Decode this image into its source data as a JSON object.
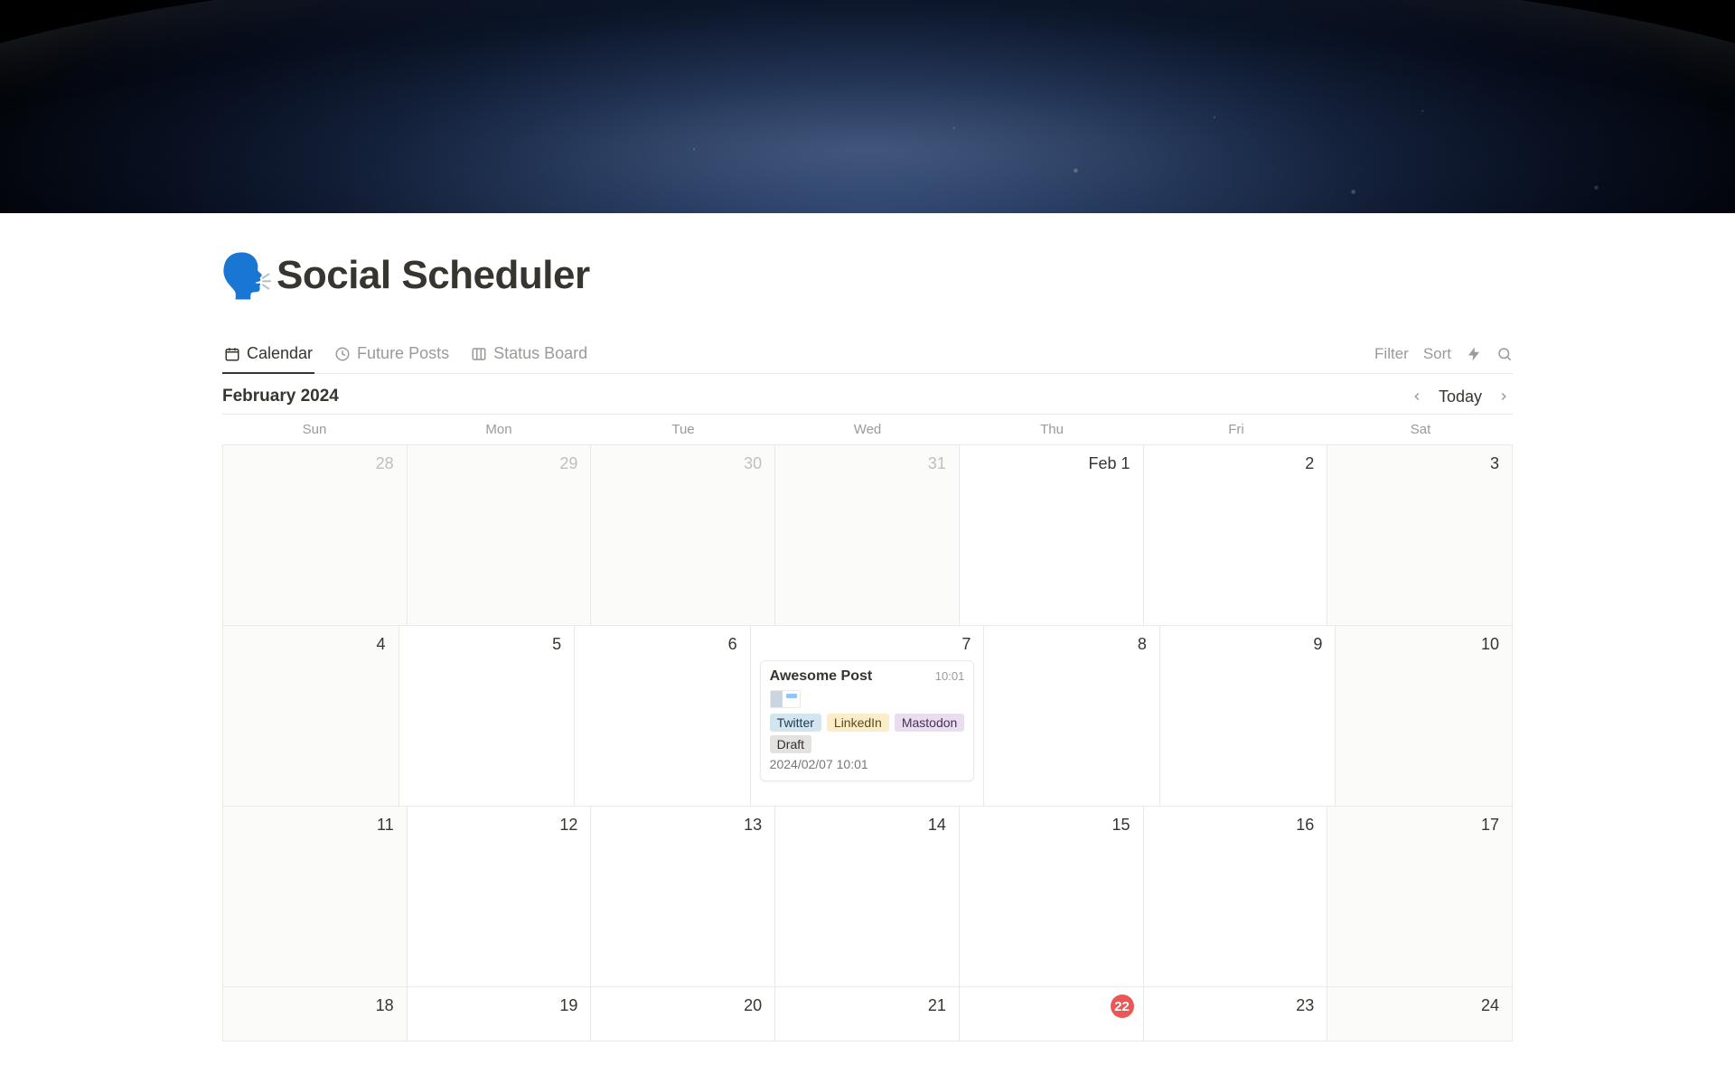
{
  "page": {
    "icon": "🗣️",
    "title": "Social Scheduler"
  },
  "tabs": {
    "calendar": "Calendar",
    "future": "Future Posts",
    "status": "Status Board"
  },
  "toolbar": {
    "filter": "Filter",
    "sort": "Sort"
  },
  "calendar": {
    "month_label": "February 2024",
    "today_label": "Today",
    "weekdays": {
      "sun": "Sun",
      "mon": "Mon",
      "tue": "Tue",
      "wed": "Wed",
      "thu": "Thu",
      "fri": "Fri",
      "sat": "Sat"
    },
    "weeks": [
      {
        "d0": "28",
        "d1": "29",
        "d2": "30",
        "d3": "31",
        "d4": "Feb 1",
        "d5": "2",
        "d6": "3"
      },
      {
        "d0": "4",
        "d1": "5",
        "d2": "6",
        "d3": "7",
        "d4": "8",
        "d5": "9",
        "d6": "10"
      },
      {
        "d0": "11",
        "d1": "12",
        "d2": "13",
        "d3": "14",
        "d4": "15",
        "d5": "16",
        "d6": "17"
      },
      {
        "d0": "18",
        "d1": "19",
        "d2": "20",
        "d3": "21",
        "d4": "22",
        "d5": "23",
        "d6": "24"
      }
    ],
    "today_day": "22"
  },
  "event": {
    "title": "Awesome Post",
    "time": "10:01",
    "tags": {
      "twitter": "Twitter",
      "linkedin": "LinkedIn",
      "mastodon": "Mastodon"
    },
    "status": "Draft",
    "datetime": "2024/02/07 10:01"
  }
}
